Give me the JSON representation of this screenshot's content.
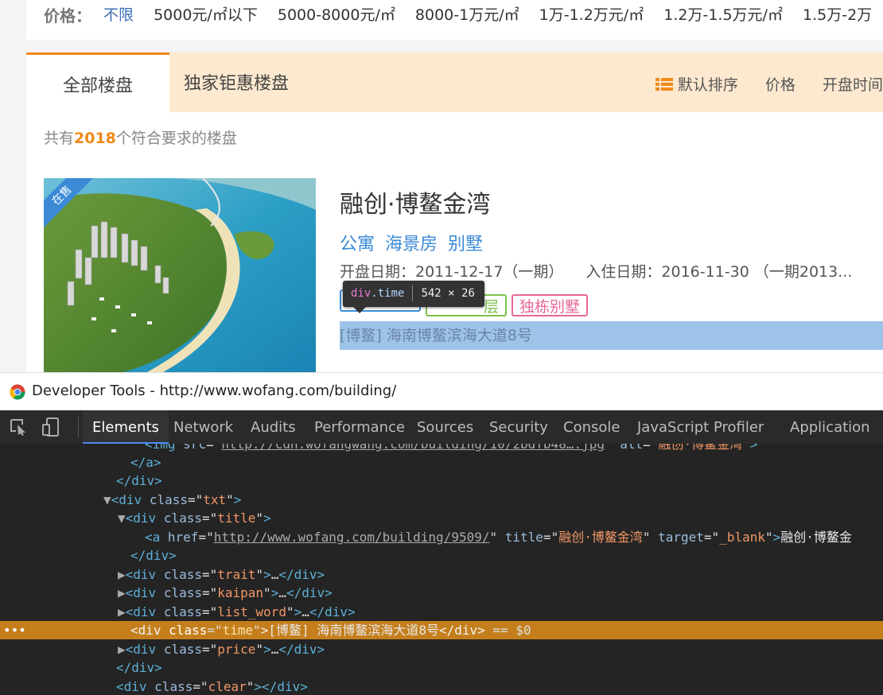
{
  "filter": {
    "label": "价格：",
    "options": [
      "不限",
      "5000元/㎡以下",
      "5000-8000元/㎡",
      "8000-1万元/㎡",
      "1万-1.2万元/㎡",
      "1.2万-1.5万元/㎡",
      "1.5万-2万"
    ]
  },
  "tabs": {
    "all": "全部楼盘",
    "exclusive": "独家钜惠楼盘"
  },
  "sorts": {
    "default": "默认排序",
    "price": "价格",
    "open": "开盘时间"
  },
  "count": {
    "prefix": "共有",
    "number": "2018",
    "suffix": "个符合要求的楼盘"
  },
  "listing": {
    "badge": "在售",
    "title": "融创·博鳌金湾",
    "types": [
      "公寓",
      "海景房",
      "别墅"
    ],
    "open_date": "开盘日期：2011-12-17（一期）",
    "move_date": "入住日期：2016-11-30 （一期2013...",
    "labels": [
      "",
      "层",
      "独栋别墅"
    ],
    "address": "[博鳌] 海南博鳌滨海大道8号"
  },
  "tooltip": {
    "tag": "div",
    "class": ".time",
    "size": "542 × 26"
  },
  "devtools": {
    "window_title": "Developer Tools - http://www.wofang.com/building/",
    "tabs": [
      "Elements",
      "Network",
      "Audits",
      "Performance",
      "Sources",
      "Security",
      "Console",
      "JavaScript Profiler",
      "Application"
    ],
    "active_tab": "Elements",
    "img_src": "http://cdn.wofangwang.com/building/10/2bdfb48….jpg",
    "img_alt": "融创·博鳌金湾",
    "a_href": "http://www.wofang.com/building/9509/",
    "a_title": "融创·博鳌金湾",
    "a_target": "_blank",
    "a_text": "融创·博鳌金",
    "classes": [
      "txt",
      "title",
      "trait",
      "kaipan",
      "list_word",
      "time",
      "price",
      "clear"
    ],
    "time_text": "[博鳌] 海南博鳌滨海大道8号",
    "selected_marker": "== $0"
  }
}
